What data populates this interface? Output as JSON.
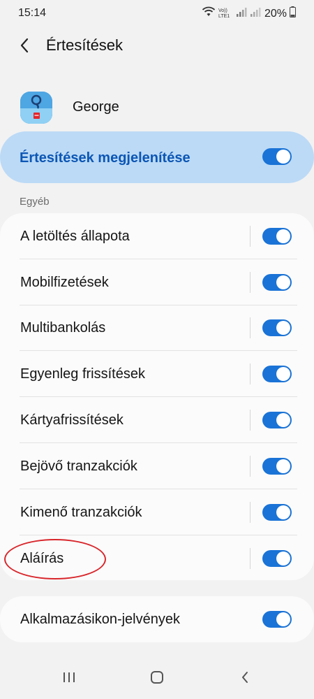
{
  "status": {
    "time": "15:14",
    "network_label": "Vo)) LTE1",
    "battery": "20%"
  },
  "app_bar": {
    "title": "Értesítések"
  },
  "app": {
    "name": "George"
  },
  "master": {
    "label": "Értesítések megjelenítése",
    "enabled": true
  },
  "section": {
    "label": "Egyéb"
  },
  "items": [
    {
      "label": "A letöltés állapota",
      "enabled": true
    },
    {
      "label": "Mobilfizetések",
      "enabled": true
    },
    {
      "label": "Multibankolás",
      "enabled": true
    },
    {
      "label": "Egyenleg frissítések",
      "enabled": true
    },
    {
      "label": "Kártyafrissítések",
      "enabled": true
    },
    {
      "label": "Bejövő tranzakciók",
      "enabled": true
    },
    {
      "label": "Kimenő tranzakciók",
      "enabled": true
    },
    {
      "label": "Aláírás",
      "enabled": true
    }
  ],
  "badges": {
    "label": "Alkalmazásikon-jelvények",
    "enabled": true
  },
  "colors": {
    "accent": "#1a73d6",
    "master_bg": "#bcdaf6",
    "master_text": "#0c56b5",
    "annotation": "#d8262b"
  },
  "icons": [
    "back-arrow-icon",
    "wifi-icon",
    "signal-icon",
    "battery-icon",
    "recents-icon",
    "home-icon",
    "nav-back-icon"
  ]
}
